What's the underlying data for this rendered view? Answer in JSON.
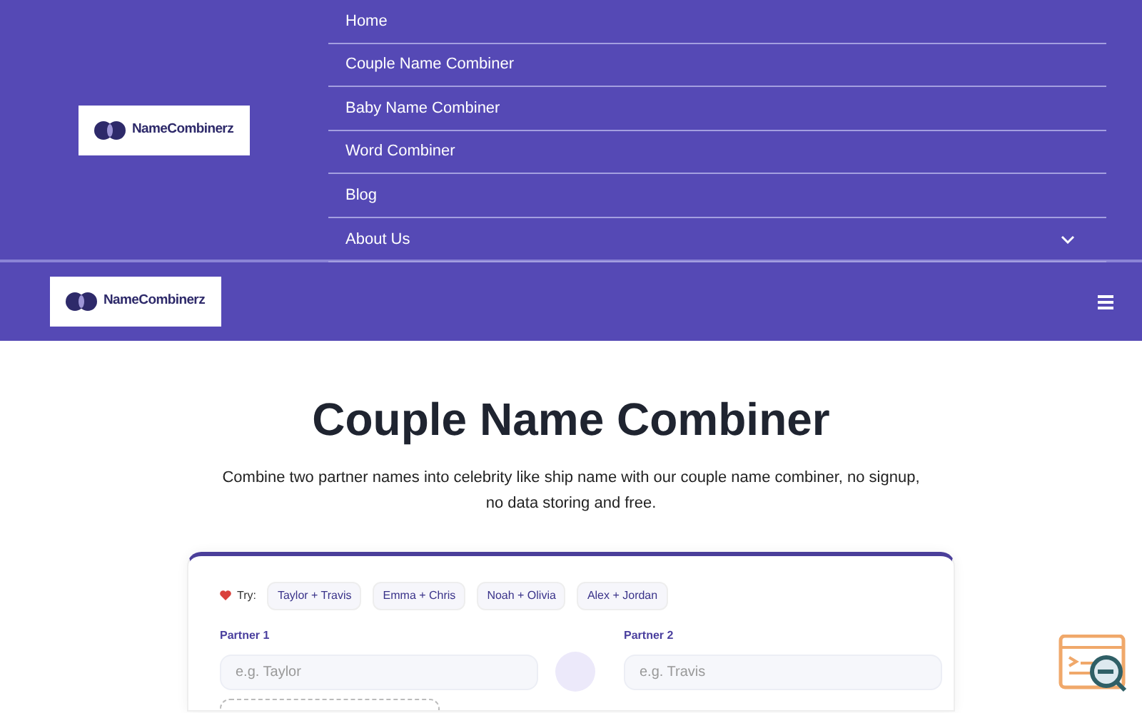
{
  "brand": {
    "name": "NameCombinerz"
  },
  "menu": [
    {
      "label": "Home",
      "has_submenu": false
    },
    {
      "label": "Couple Name Combiner",
      "has_submenu": false
    },
    {
      "label": "Baby Name Combiner",
      "has_submenu": false
    },
    {
      "label": "Word Combiner",
      "has_submenu": false
    },
    {
      "label": "Blog",
      "has_submenu": false
    },
    {
      "label": "About Us",
      "has_submenu": true
    }
  ],
  "mobile_bar": {
    "brand": "NameCombinerz"
  },
  "hero": {
    "title": "Couple Name Combiner",
    "subtitle": "Combine two partner names into celebrity like ship name with our couple name combiner, no signup, no data storing and free."
  },
  "form": {
    "try_label": "Try:",
    "examples": [
      "Taylor + Travis",
      "Emma + Chris",
      "Noah + Olivia",
      "Alex + Jordan"
    ],
    "fields": [
      {
        "label": "Partner 1",
        "placeholder": "e.g. Taylor"
      },
      {
        "label": "Partner 2",
        "placeholder": "e.g. Travis"
      }
    ]
  }
}
